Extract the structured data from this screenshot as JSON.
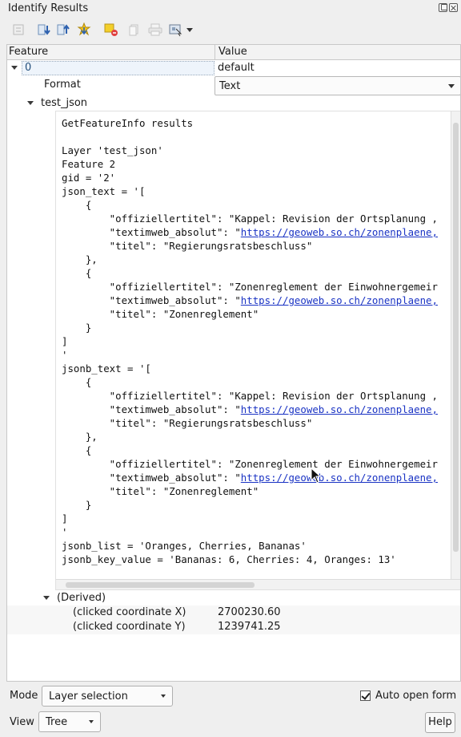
{
  "window": {
    "title": "Identify Results"
  },
  "toolbar": {
    "icons": [
      "expand-tree-icon",
      "collapse-all-icon",
      "expand-all-icon",
      "expand-new-results-icon",
      "clear-highlights-icon",
      "copy-icon",
      "print-icon",
      "select-features-icon"
    ]
  },
  "tree": {
    "headers": {
      "feature": "Feature",
      "value": "Value"
    },
    "feature_row": {
      "id": "0",
      "value": "default"
    },
    "format_row": {
      "label": "Format",
      "value": "Text"
    },
    "layer_row": {
      "label": "test_json"
    },
    "text_lines": [
      "GetFeatureInfo results",
      "",
      "Layer 'test_json'",
      "Feature 2",
      "gid = '2'",
      "json_text = '[",
      "    {",
      "        \"offiziellertitel\": \"Kappel: Revision der Ortsplanung ,",
      "        \"textimweb_absolut\": \"|LINK|",
      "        \"titel\": \"Regierungsratsbeschluss\"",
      "    },",
      "    {",
      "        \"offiziellertitel\": \"Zonenreglement der Einwohnergemeir",
      "        \"textimweb_absolut\": \"|LINK|",
      "        \"titel\": \"Zonenreglement\"",
      "    }",
      "]",
      "'",
      "jsonb_text = '[",
      "    {",
      "        \"offiziellertitel\": \"Kappel: Revision der Ortsplanung ,",
      "        \"textimweb_absolut\": \"|LINK|",
      "        \"titel\": \"Regierungsratsbeschluss\"",
      "    },",
      "    {",
      "        \"offiziellertitel\": \"Zonenreglement der Einwohnergemeir",
      "        \"textimweb_absolut\": \"|LINK|",
      "        \"titel\": \"Zonenreglement\"",
      "    }",
      "]",
      "'",
      "jsonb_list = 'Oranges, Cherries, Bananas'",
      "jsonb_key_value = 'Bananas: 6, Cherries: 4, Oranges: 13'"
    ],
    "link_text": "https://geoweb.so.ch/zonenplaene,",
    "derived": {
      "label": "(Derived)",
      "x_label": "(clicked coordinate X)",
      "x_value": "2700230.60",
      "y_label": "(clicked coordinate Y)",
      "y_value": "1239741.25"
    }
  },
  "bottom": {
    "mode_label": "Mode",
    "mode_value": "Layer selection",
    "auto_open_label": "Auto open form",
    "auto_open_checked": true,
    "view_label": "View",
    "view_value": "Tree",
    "help_label": "Help"
  }
}
